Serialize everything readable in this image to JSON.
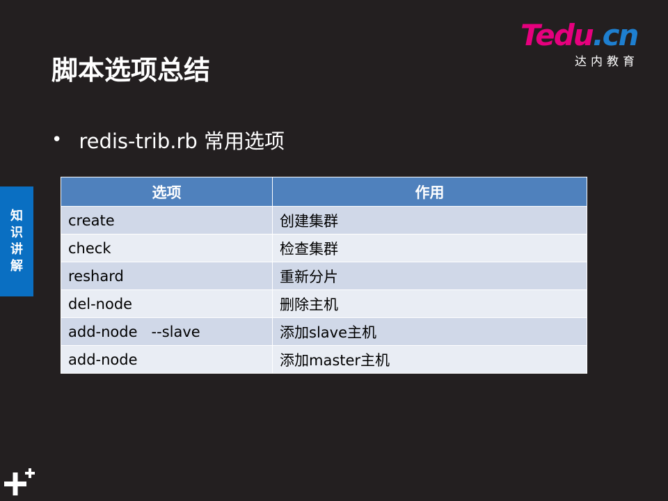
{
  "logo": {
    "word_t": "T",
    "word_rest": "edu",
    "word_cn": ".cn",
    "subtitle": "达内教育"
  },
  "title": "脚本选项总结",
  "bullet": {
    "text": "redis-trib.rb 常用选项"
  },
  "side_tab": {
    "chars": [
      "知",
      "识",
      "讲",
      "解"
    ]
  },
  "table": {
    "headers": [
      "选项",
      "作用"
    ],
    "rows": [
      [
        "create",
        "创建集群"
      ],
      [
        "check",
        "检查集群"
      ],
      [
        "reshard",
        "重新分片"
      ],
      [
        "del-node",
        "删除主机"
      ],
      [
        "add-node   --slave",
        "添加slave主机"
      ],
      [
        "add-node",
        "添加master主机"
      ]
    ]
  },
  "colors": {
    "background": "#231f20",
    "header": "#4f81bd",
    "row_odd": "#d0d8e8",
    "row_even": "#e9edf4",
    "side_tab": "#0a6fc2",
    "logo_magenta": "#e6007e",
    "logo_blue": "#1e7fd0"
  },
  "icons": [
    "plus-plus-icon"
  ]
}
